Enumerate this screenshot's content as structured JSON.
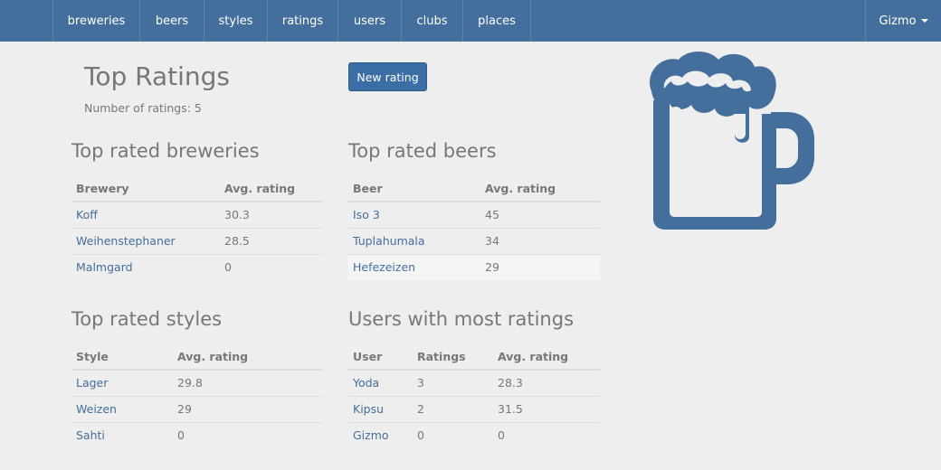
{
  "nav": {
    "items": [
      "breweries",
      "beers",
      "styles",
      "ratings",
      "users",
      "clubs",
      "places"
    ],
    "user": "Gizmo"
  },
  "colors": {
    "navbar": "#446e9b",
    "link": "#446e9b",
    "button": "#3a6ea5",
    "background": "#eeeeee"
  },
  "header": {
    "title": "Top Ratings",
    "count_label": "Number of ratings: 5",
    "new_button": "New rating"
  },
  "breweries": {
    "title": "Top rated breweries",
    "columns": [
      "Brewery",
      "Avg. rating"
    ],
    "rows": [
      [
        "Koff",
        "30.3"
      ],
      [
        "Weihenstephaner",
        "28.5"
      ],
      [
        "Malmgard",
        "0"
      ]
    ]
  },
  "beers": {
    "title": "Top rated beers",
    "columns": [
      "Beer",
      "Avg. rating"
    ],
    "rows": [
      [
        "Iso 3",
        "45"
      ],
      [
        "Tuplahumala",
        "34"
      ],
      [
        "Hefezeizen",
        "29"
      ]
    ]
  },
  "styles": {
    "title": "Top rated styles",
    "columns": [
      "Style",
      "Avg. rating"
    ],
    "rows": [
      [
        "Lager",
        "29.8"
      ],
      [
        "Weizen",
        "29"
      ],
      [
        "Sahti",
        "0"
      ]
    ]
  },
  "users": {
    "title": "Users with most ratings",
    "columns": [
      "User",
      "Ratings",
      "Avg. rating"
    ],
    "rows": [
      [
        "Yoda",
        "3",
        "28.3"
      ],
      [
        "Kipsu",
        "2",
        "31.5"
      ],
      [
        "Gizmo",
        "0",
        "0"
      ]
    ]
  },
  "logo_icon": "beer-mug-icon"
}
